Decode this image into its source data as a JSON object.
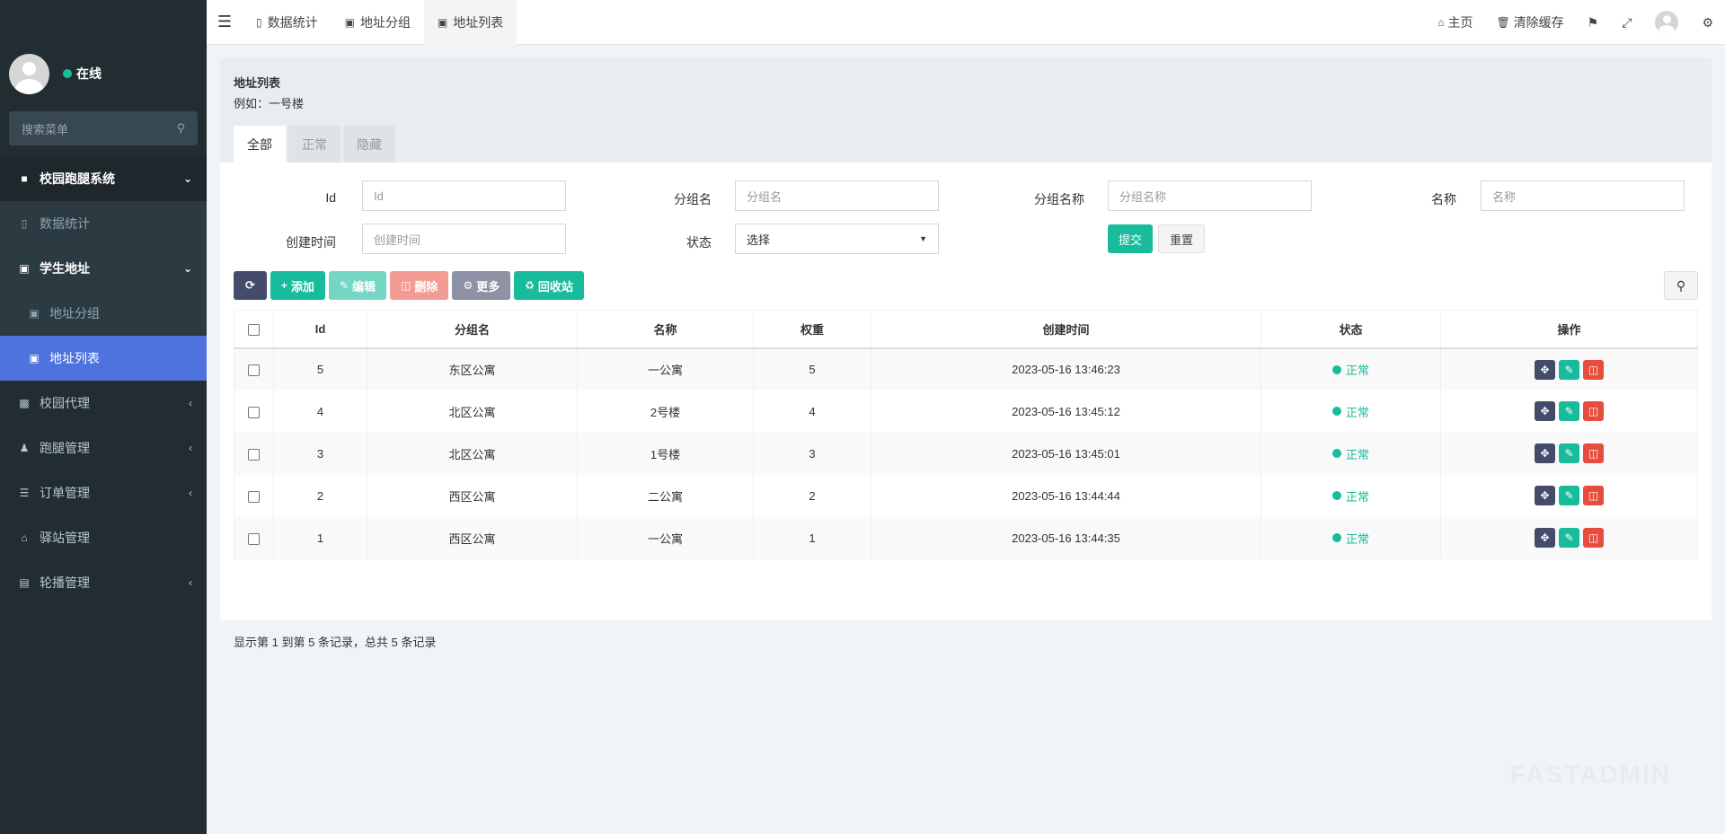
{
  "user": {
    "status": "在线"
  },
  "sidebar": {
    "search_placeholder": "搜索菜单",
    "items": [
      {
        "label": "校园跑腿系统",
        "icon": "backpack-icon"
      },
      {
        "label": "数据统计",
        "icon": "bar-chart-icon"
      },
      {
        "label": "学生地址",
        "icon": "address-card-icon"
      },
      {
        "label": "地址分组",
        "icon": "address-card-icon"
      },
      {
        "label": "地址列表",
        "icon": "address-card-icon"
      },
      {
        "label": "校园代理",
        "icon": "badge-icon"
      },
      {
        "label": "跑腿管理",
        "icon": "user-icon"
      },
      {
        "label": "订单管理",
        "icon": "list-icon"
      },
      {
        "label": "驿站管理",
        "icon": "home-icon"
      },
      {
        "label": "轮播管理",
        "icon": "image-icon"
      }
    ]
  },
  "topnav": {
    "tabs": [
      {
        "label": "数据统计"
      },
      {
        "label": "地址分组"
      },
      {
        "label": "地址列表"
      }
    ],
    "home": "主页",
    "clear_cache": "清除缓存"
  },
  "panel": {
    "title": "地址列表",
    "subtitle": "例如：一号楼",
    "tabs": [
      "全部",
      "正常",
      "隐藏"
    ]
  },
  "form": {
    "id_label": "Id",
    "id_placeholder": "Id",
    "group_label": "分组名",
    "group_placeholder": "分组名",
    "group_name_label": "分组名称",
    "group_name_placeholder": "分组名称",
    "name_label": "名称",
    "name_placeholder": "名称",
    "created_label": "创建时间",
    "created_placeholder": "创建时间",
    "status_label": "状态",
    "status_value": "选择",
    "submit": "提交",
    "reset": "重置"
  },
  "toolbar": {
    "add": "添加",
    "edit": "编辑",
    "delete": "删除",
    "more": "更多",
    "recycle": "回收站"
  },
  "table": {
    "headers": [
      "Id",
      "分组名",
      "名称",
      "权重",
      "创建时间",
      "状态",
      "操作"
    ],
    "rows": [
      {
        "id": "5",
        "group": "东区公寓",
        "name": "一公寓",
        "weight": "5",
        "created": "2023-05-16 13:46:23",
        "status": "正常"
      },
      {
        "id": "4",
        "group": "北区公寓",
        "name": "2号楼",
        "weight": "4",
        "created": "2023-05-16 13:45:12",
        "status": "正常"
      },
      {
        "id": "3",
        "group": "北区公寓",
        "name": "1号楼",
        "weight": "3",
        "created": "2023-05-16 13:45:01",
        "status": "正常"
      },
      {
        "id": "2",
        "group": "西区公寓",
        "name": "二公寓",
        "weight": "2",
        "created": "2023-05-16 13:44:44",
        "status": "正常"
      },
      {
        "id": "1",
        "group": "西区公寓",
        "name": "一公寓",
        "weight": "1",
        "created": "2023-05-16 13:44:35",
        "status": "正常"
      }
    ]
  },
  "pager": {
    "text": "显示第 1 到第 5 条记录，总共 5 条记录"
  },
  "watermark": "FASTADMIN",
  "colors": {
    "accent": "#18bc9c",
    "sidebar": "#222d32",
    "active": "#4e73df",
    "danger": "#e74c3c"
  }
}
